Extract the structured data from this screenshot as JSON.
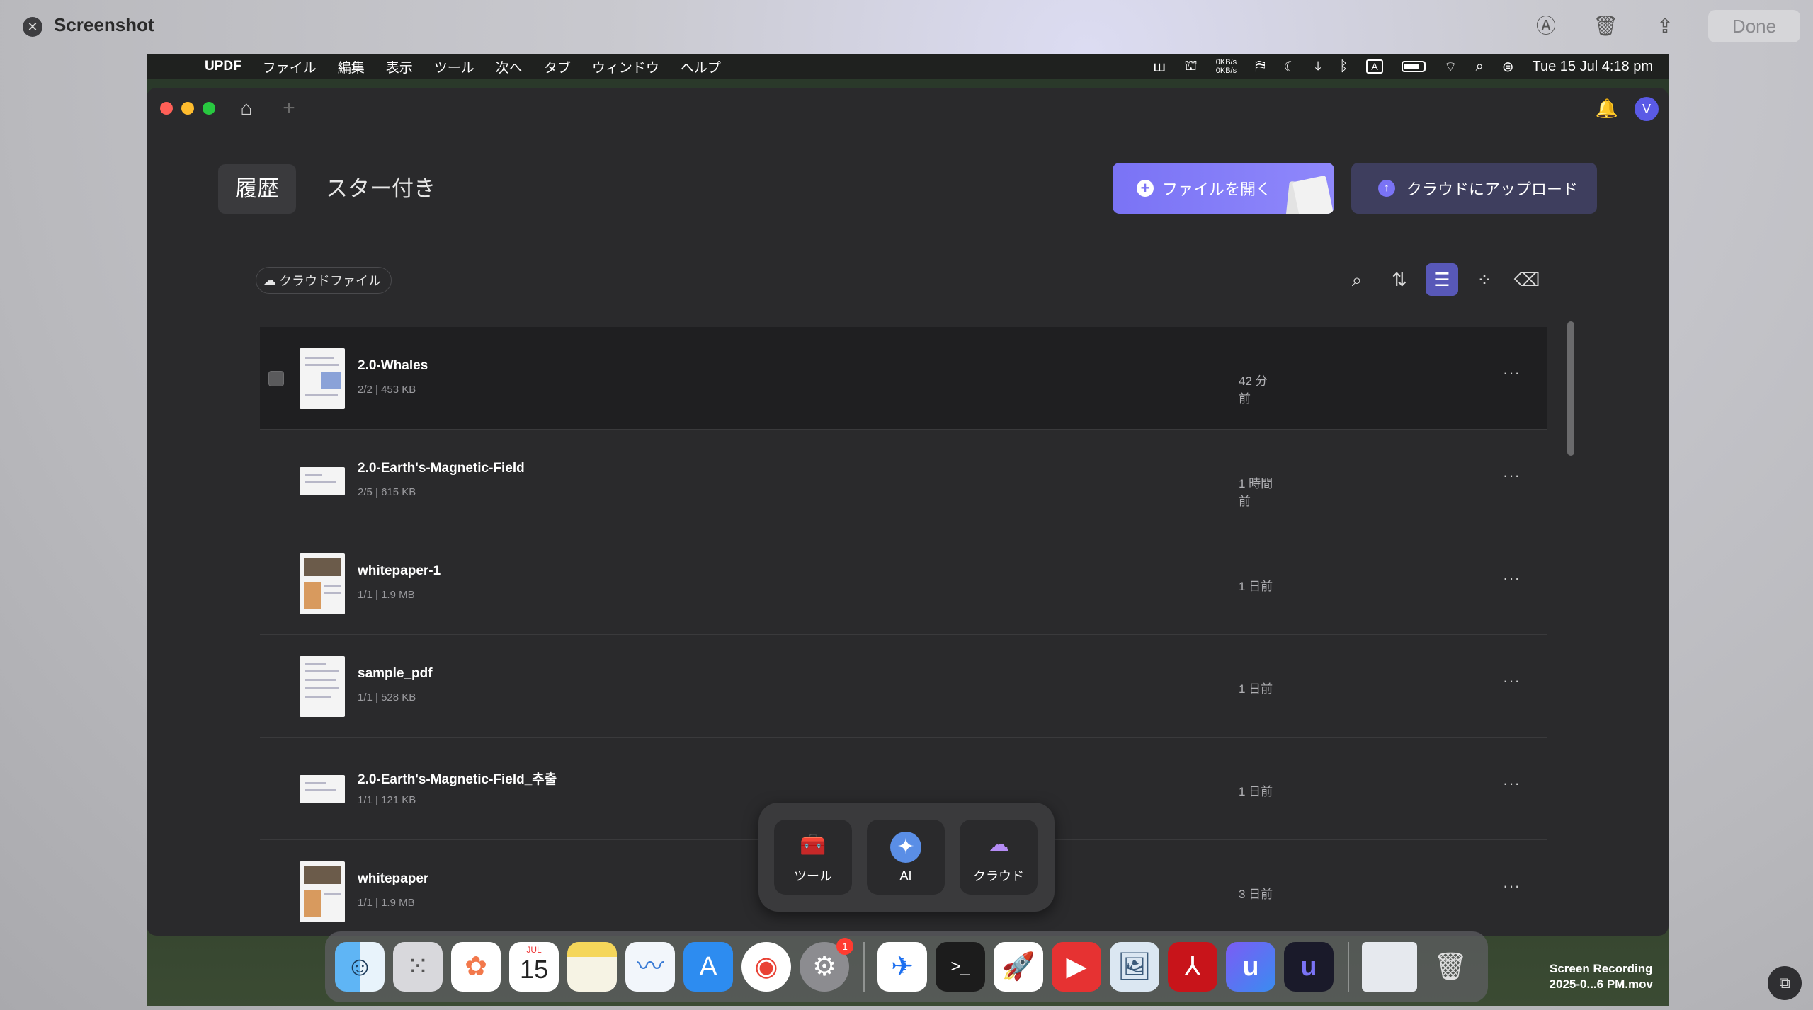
{
  "viewer": {
    "title": "Screenshot",
    "done_label": "Done",
    "icons": [
      "markup-icon",
      "trash-icon",
      "share-icon"
    ]
  },
  "menubar": {
    "items": [
      "UPDF",
      "ファイル",
      "編集",
      "表示",
      "ツール",
      "次へ",
      "タブ",
      "ウィンドウ",
      "ヘルプ"
    ],
    "net_up": "0KB/s",
    "net_down": "0KB/s",
    "input_label": "A",
    "clock": "Tue 15 Jul  4:18 pm"
  },
  "app": {
    "tabs": [
      "履歴",
      "スター付き"
    ],
    "open_file_label": "ファイルを開く",
    "upload_label": "クラウドにアップロード",
    "cloud_chip_label": "クラウドファイル",
    "avatar_initial": "V"
  },
  "files": [
    {
      "name": "2.0-Whales",
      "pages": "2/2",
      "size": "453 KB",
      "time": "42 分前"
    },
    {
      "name": "2.0-Earth's-Magnetic-Field",
      "pages": "2/5",
      "size": "615 KB",
      "time": "1 時間前"
    },
    {
      "name": "whitepaper-1",
      "pages": "1/1",
      "size": "1.9 MB",
      "time": "1 日前"
    },
    {
      "name": "sample_pdf",
      "pages": "1/1",
      "size": "528 KB",
      "time": "1 日前"
    },
    {
      "name": "2.0-Earth's-Magnetic-Field_추출",
      "pages": "1/1",
      "size": "121 KB",
      "time": "1 日前"
    },
    {
      "name": "whitepaper",
      "pages": "1/1",
      "size": "1.9 MB",
      "time": "3 日前"
    }
  ],
  "floating_bar": {
    "items": [
      "ツール",
      "AI",
      "クラウド"
    ]
  },
  "dock": {
    "calendar_month": "JUL",
    "calendar_day": "15",
    "settings_badge": "1",
    "recording_label_line1": "Screen Recording",
    "recording_label_line2": "2025-0...6 PM.mov"
  },
  "colors": {
    "accent": "#7a73f5",
    "window_bg": "#2a2a2c",
    "row_highlight": "#1f1f21"
  }
}
